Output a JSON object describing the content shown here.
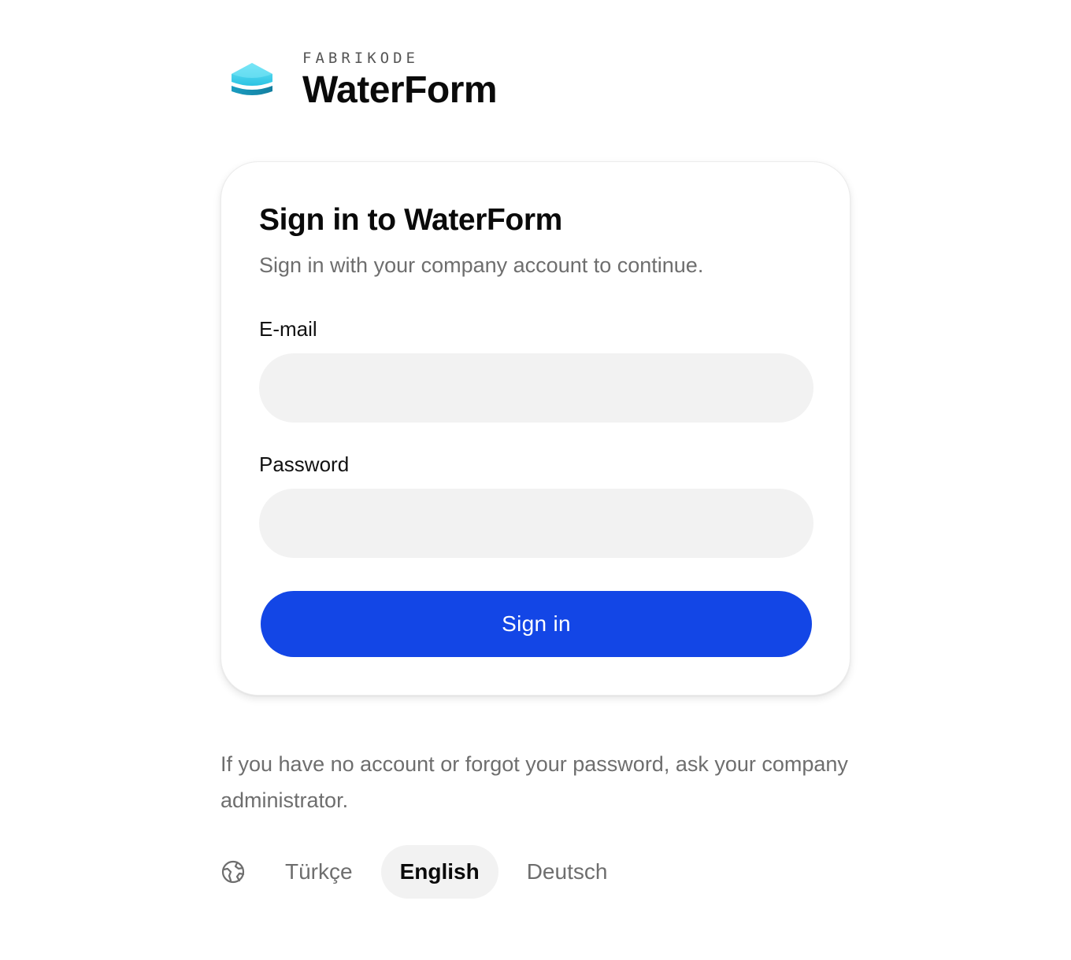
{
  "brand": {
    "logo_icon": "water-drop-cylinder-icon",
    "company": "FABRIKODE",
    "product": "WaterForm"
  },
  "card": {
    "title": "Sign in to WaterForm",
    "subtitle": "Sign in with your company account to continue.",
    "email_label": "E-mail",
    "email_value": "",
    "password_label": "Password",
    "password_value": "",
    "submit_label": "Sign in"
  },
  "help": {
    "text": "If you have no account or forgot your password, ask your company administrator."
  },
  "language": {
    "icon": "globe-icon",
    "options": [
      "Türkçe",
      "English",
      "Deutsch"
    ],
    "selected": "English"
  },
  "colors": {
    "accent": "#1346e6",
    "input_bg": "#f2f2f2",
    "muted_text": "#6e6e6e",
    "logo_top": "#4fd6ee",
    "logo_bottom": "#1592b3"
  }
}
